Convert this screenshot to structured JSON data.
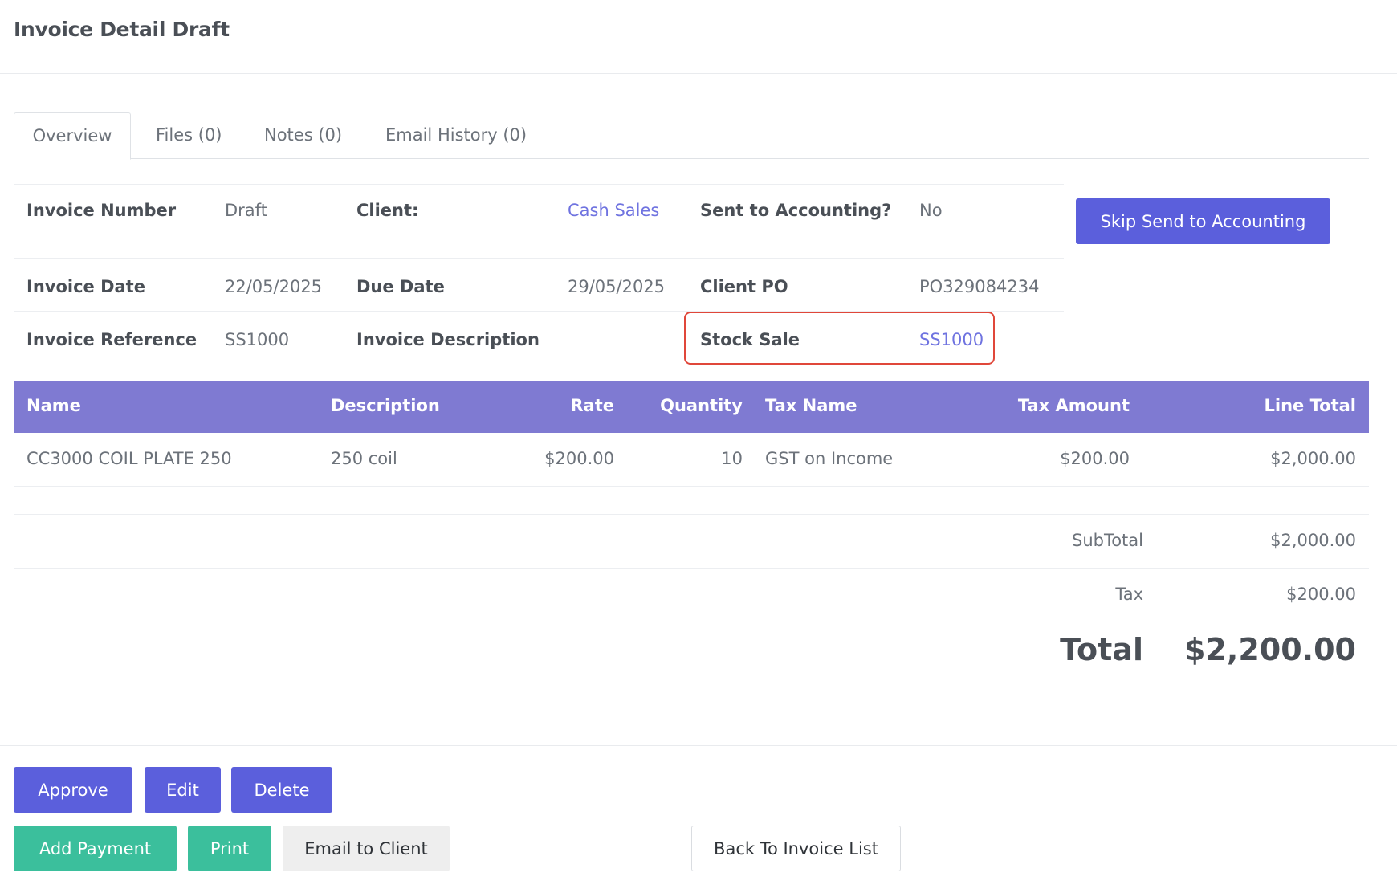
{
  "page": {
    "title": "Invoice Detail Draft"
  },
  "tabs": [
    {
      "label": "Overview"
    },
    {
      "label": "Files (0)"
    },
    {
      "label": "Notes (0)"
    },
    {
      "label": "Email History (0)"
    }
  ],
  "info": {
    "invoice_number": {
      "label": "Invoice Number",
      "value": "Draft"
    },
    "client": {
      "label": "Client:",
      "value": "Cash Sales"
    },
    "sent_to_accounting": {
      "label": "Sent to Accounting?",
      "value": "No"
    },
    "invoice_date": {
      "label": "Invoice Date",
      "value": "22/05/2025"
    },
    "due_date": {
      "label": "Due Date",
      "value": "29/05/2025"
    },
    "client_po": {
      "label": "Client PO",
      "value": "PO329084234"
    },
    "invoice_reference": {
      "label": "Invoice Reference",
      "value": "SS1000"
    },
    "invoice_description": {
      "label": "Invoice Description",
      "value": ""
    },
    "stock_sale": {
      "label": "Stock Sale",
      "value": "SS1000"
    }
  },
  "skip_button": {
    "label": "Skip Send to Accounting"
  },
  "items": {
    "headers": {
      "name": "Name",
      "description": "Description",
      "rate": "Rate",
      "quantity": "Quantity",
      "tax_name": "Tax Name",
      "tax_amount": "Tax Amount",
      "line_total": "Line Total"
    },
    "rows": [
      {
        "name": "CC3000 COIL PLATE 250",
        "description": "250 coil",
        "rate": "$200.00",
        "quantity": "10",
        "tax_name": "GST on Income",
        "tax_amount": "$200.00",
        "line_total": "$2,000.00"
      }
    ]
  },
  "totals": {
    "subtotal": {
      "label": "SubTotal",
      "value": "$2,000.00"
    },
    "tax": {
      "label": "Tax",
      "value": "$200.00"
    },
    "total": {
      "label": "Total",
      "value": "$2,200.00"
    }
  },
  "actions": {
    "approve": "Approve",
    "edit": "Edit",
    "delete": "Delete",
    "add_payment": "Add Payment",
    "print": "Print",
    "email_client": "Email to Client",
    "back": "Back To Invoice List"
  },
  "colors": {
    "primary": "#5b5fdc",
    "success": "#3bbf9c",
    "table_header": "#7f7ad2",
    "link": "#6f73e0",
    "highlight": "#e0473a"
  }
}
